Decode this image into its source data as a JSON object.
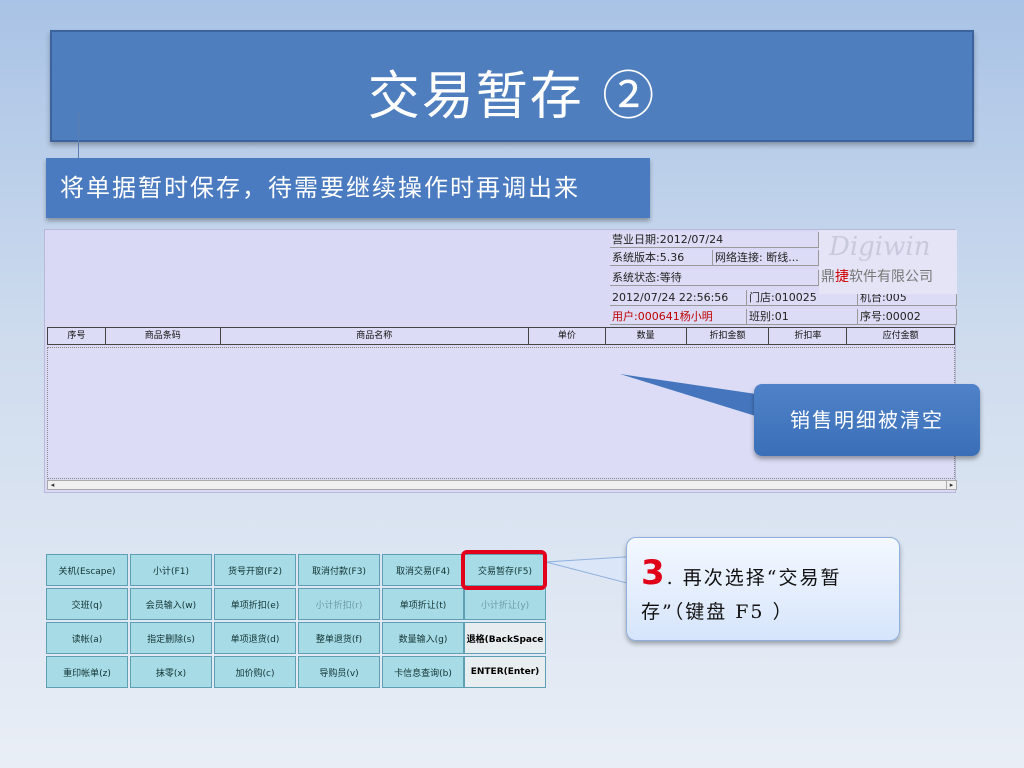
{
  "slide": {
    "title": "交易暂存 ②",
    "subtitle": "将单据暂时保存，待需要继续操作时再调出来"
  },
  "pos": {
    "business_date": "营业日期:2012/07/24",
    "version": "系统版本:5.36",
    "network": "网络连接: 断线...",
    "status": "系统状态:等待",
    "datetime": "2012/07/24 22:56:56",
    "store": "门店:010025",
    "machine": "机台:005",
    "user": "用户:000641杨小明",
    "shift": "班别:01",
    "serial": "序号:00002",
    "logo_script": "Digiwin",
    "logo_name_pre": "鼎",
    "logo_name_hl": "捷",
    "logo_name_post": "软件有限公司",
    "columns": [
      "序号",
      "商品条码",
      "商品名称",
      "单价",
      "数量",
      "折扣金额",
      "折扣率",
      "应付金额"
    ]
  },
  "callouts": {
    "sales_cleared": "销售明细被清空",
    "step_number": "3",
    "step_text": ". 再次选择“交易暂存”（键盘 F5 ）"
  },
  "keypad": {
    "rows": [
      [
        "关机(Escape)",
        "小计(F1)",
        "货号开窗(F2)",
        "取消付款(F3)",
        "取消交易(F4)",
        "交易暂存(F5)"
      ],
      [
        "交班(q)",
        "会员输入(w)",
        "单项折扣(e)",
        "小计折扣(r)",
        "单项折让(t)",
        "小计折让(y)"
      ],
      [
        "读帐(a)",
        "指定删除(s)",
        "单项退货(d)",
        "整单退货(f)",
        "数量输入(g)",
        "退格(BackSpace"
      ],
      [
        "重印帐单(z)",
        "抹零(x)",
        "加价购(c)",
        "导购员(v)",
        "卡信息查询(b)",
        "ENTER(Enter)"
      ]
    ]
  },
  "colors": {
    "title_bg": "#4f7ebf",
    "key_bg": "#a7dbe6",
    "highlight": "#e3001b"
  }
}
